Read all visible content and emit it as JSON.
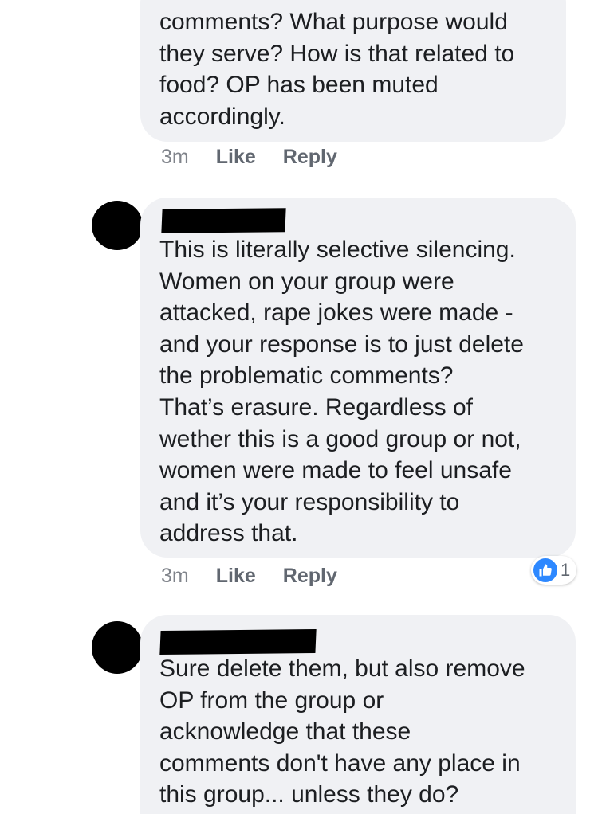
{
  "comments": [
    {
      "text_lines": "comments? What purpose would\nthey serve? How is that related to\nfood? OP has been muted\naccordingly.",
      "time": "3m",
      "like_label": "Like",
      "reply_label": "Reply"
    },
    {
      "text_lines": "This is literally selective silencing.\nWomen on your group were\nattacked, rape jokes were made -\nand your response is to just delete\nthe problematic comments?\nThat’s erasure. Regardless of\nwether this is a good group or not,\nwomen were made to feel unsafe\nand it’s your responsibility to\naddress that.",
      "time": "3m",
      "like_label": "Like",
      "reply_label": "Reply",
      "reaction_count": "1",
      "reaction_icon": "thumbs-up-icon"
    },
    {
      "text_lines": "Sure delete them, but also remove\nOP from the group or\nacknowledge that these\ncomments don't have any place in\nthis group... unless they do?"
    }
  ],
  "colors": {
    "bubble_bg": "#f0f1f4",
    "text": "#1c1e21",
    "meta": "#616770",
    "like_blue": "#2d88ff",
    "redaction": "#000000"
  }
}
